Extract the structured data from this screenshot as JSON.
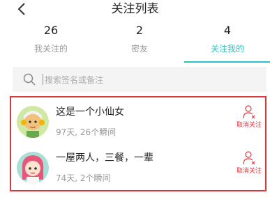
{
  "header": {
    "title": "关注列表",
    "back_icon": "chevron-left-icon"
  },
  "tabs": [
    {
      "count": "26",
      "label": "我关注的"
    },
    {
      "count": "2",
      "label": "密友"
    },
    {
      "count": "4",
      "label": "关注我的"
    }
  ],
  "active_tab": 2,
  "search": {
    "placeholder": "搜索签名或备注",
    "value": "",
    "icon": "search-icon"
  },
  "followers": [
    {
      "name": "这是一个小仙女",
      "meta": "97天, 26个瞬间",
      "action_label": "取消关注",
      "action_icon": "unfollow-person-icon"
    },
    {
      "name": "一屋两人，三餐，一辈",
      "meta": "74天, 2个瞬间",
      "action_label": "取消关注",
      "action_icon": "unfollow-person-icon"
    }
  ],
  "colors": {
    "accent": "#2cc3bf",
    "danger": "#d9393e",
    "muted": "#999999"
  }
}
